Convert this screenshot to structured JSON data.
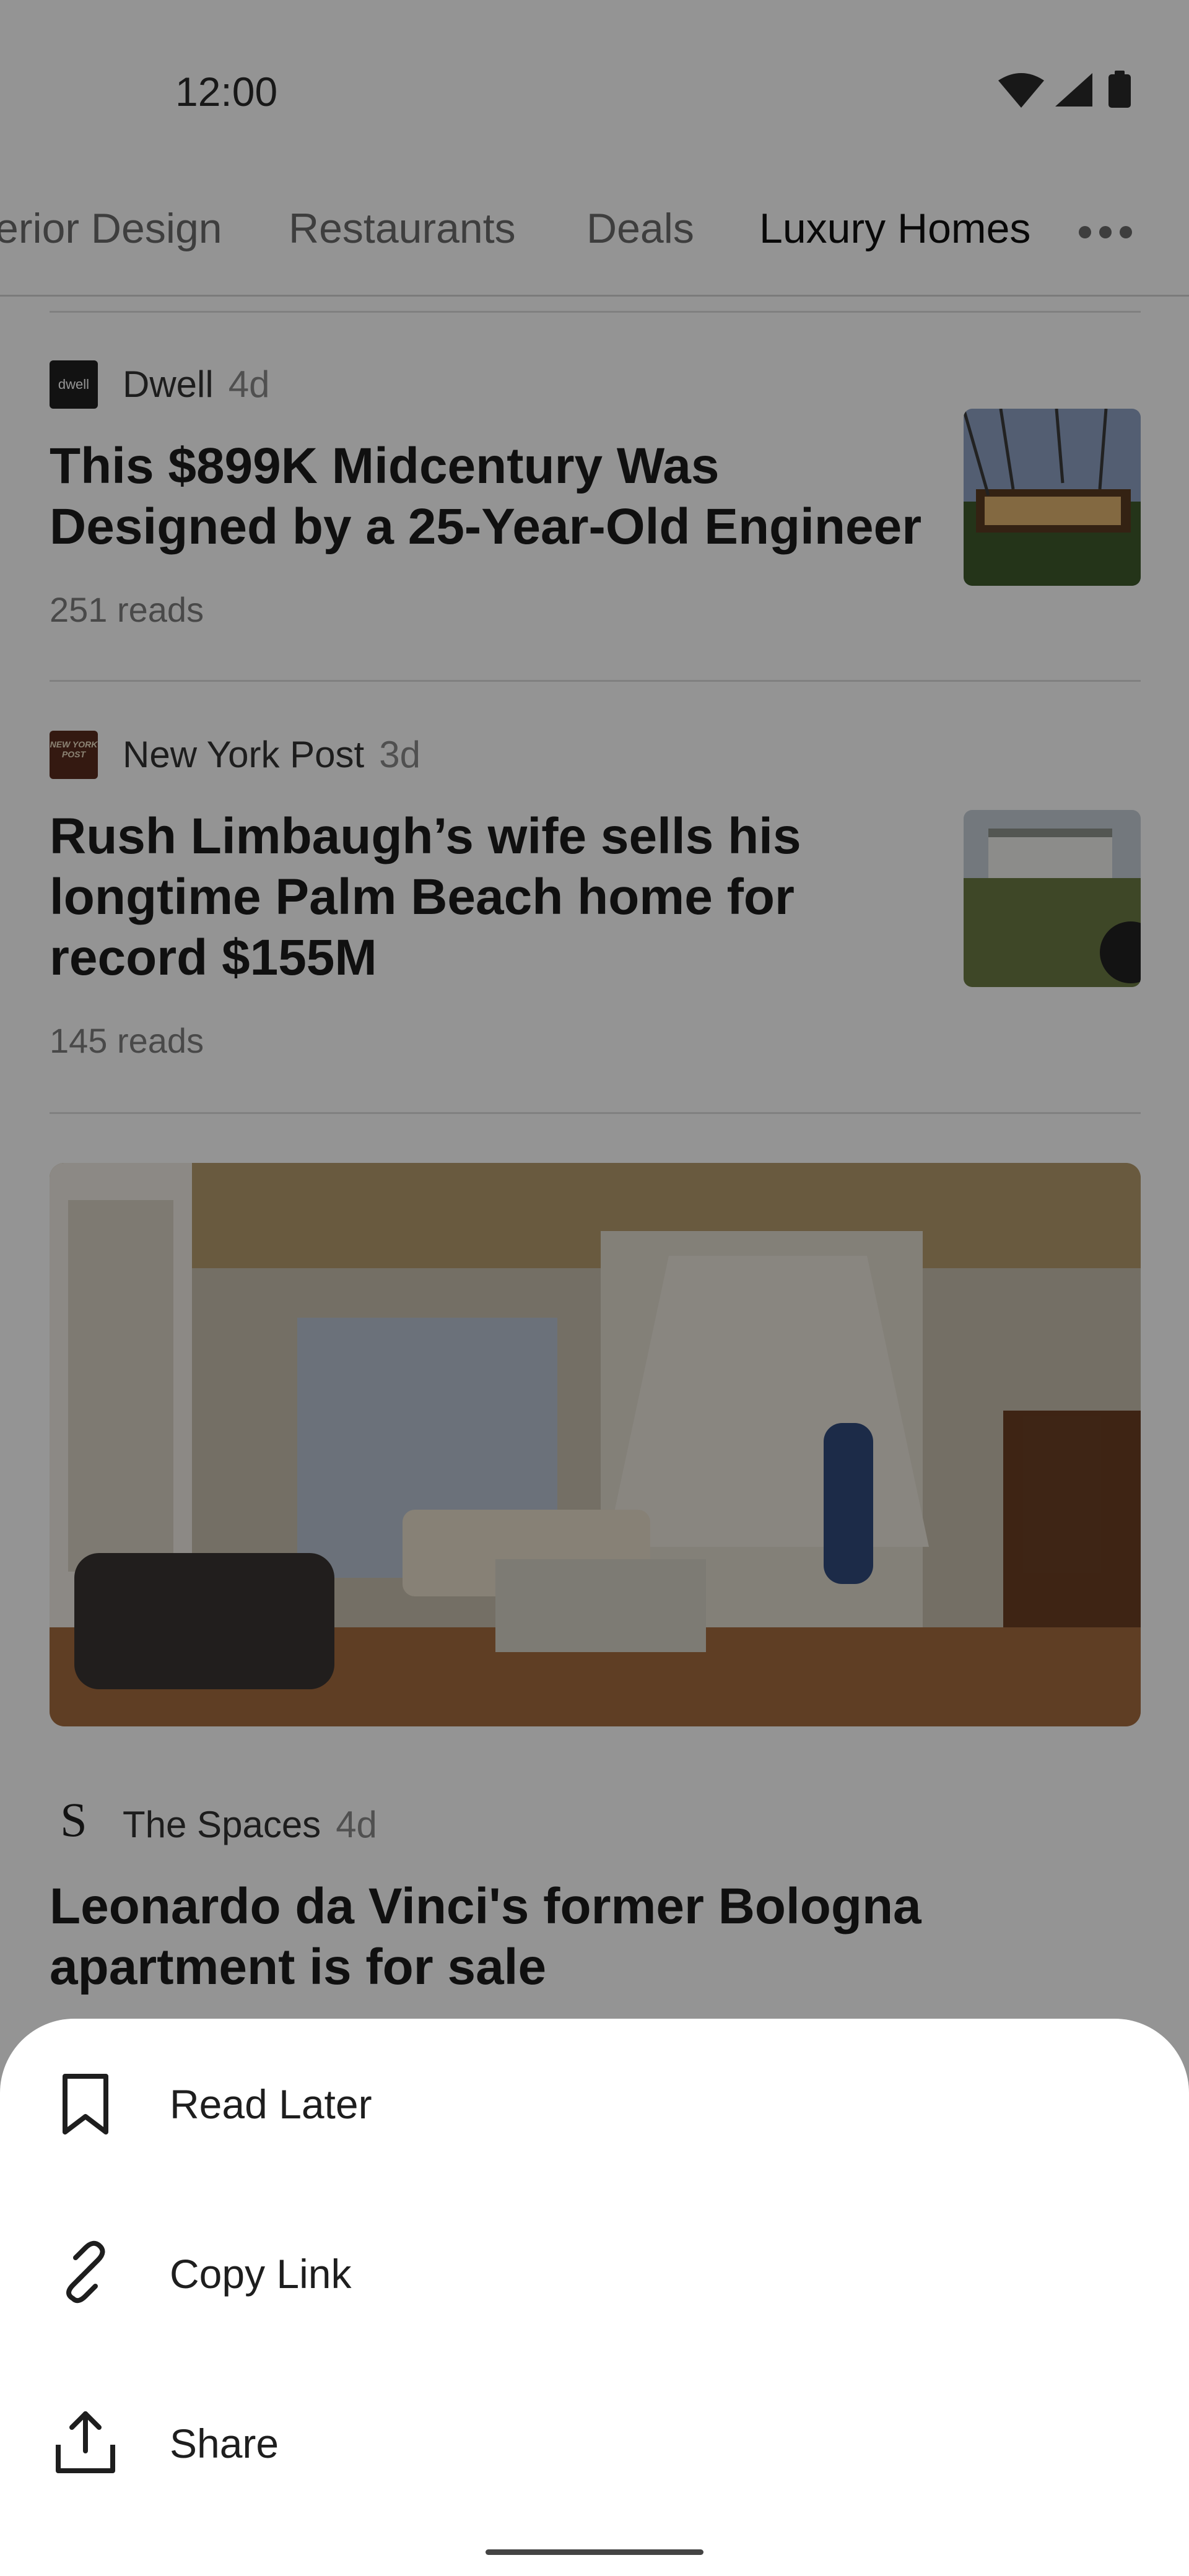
{
  "status_bar": {
    "time": "12:00"
  },
  "tabs": {
    "items": [
      {
        "label": "erior Design"
      },
      {
        "label": "Restaurants"
      },
      {
        "label": "Deals"
      },
      {
        "label": "Luxury Homes",
        "active": true
      }
    ],
    "more_icon": "more-horizontal-icon"
  },
  "articles": [
    {
      "source": "Dwell",
      "logo_text": "dwell",
      "age": "4d",
      "headline": "This $899K Midcentury Was Designed by a 25-Year-Old Engineer",
      "reads": "251 reads"
    },
    {
      "source": "New York Post",
      "logo_text": "NEW YORK POST",
      "age": "3d",
      "headline": "Rush Limbaugh’s wife sells his longtime Palm Beach home for record $155M",
      "reads": "145 reads"
    },
    {
      "source": "The Spaces",
      "logo_text": "S",
      "age": "4d",
      "headline": "Leonardo da Vinci's former Bologna apartment is for sale"
    }
  ],
  "sheet": {
    "items": [
      {
        "label": "Read Later",
        "icon": "bookmark-icon"
      },
      {
        "label": "Copy Link",
        "icon": "link-icon"
      },
      {
        "label": "Share",
        "icon": "share-icon"
      }
    ]
  },
  "colors": {
    "scrim": "#000000",
    "sheet": "#ffffff",
    "divider": "#dcdcdc"
  }
}
